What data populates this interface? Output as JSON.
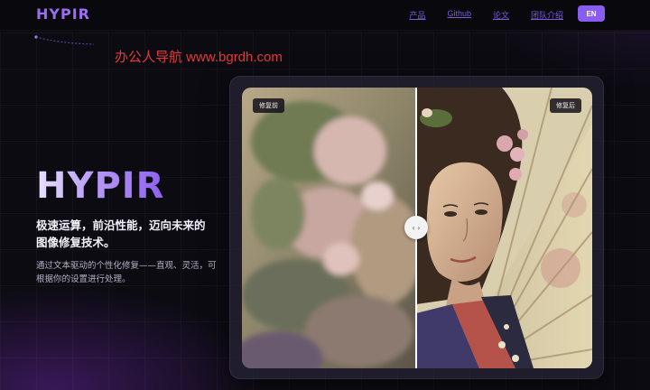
{
  "header": {
    "logo": "HYPIR",
    "nav": [
      {
        "label": "产品"
      },
      {
        "label": "Github"
      },
      {
        "label": "论文"
      },
      {
        "label": "团队介绍"
      }
    ],
    "lang_button": "EN"
  },
  "watermark": "办公人导航  www.bgrdh.com",
  "hero": {
    "title": "HYPIR",
    "subtitle": "极速运算，前沿性能，迈向未来的图像修复技术。",
    "description": "通过文本驱动的个性化修复——直观、灵活，可根据你的设置进行处理。"
  },
  "compare": {
    "before_label": "修复前",
    "after_label": "修复后",
    "handle_glyph": "‹ ›",
    "split": 0.5
  },
  "colors": {
    "accent": "#8a5cf0",
    "logo": "#9b6df2",
    "nav": "#7d5bd8",
    "watermark": "#e23a3a"
  }
}
